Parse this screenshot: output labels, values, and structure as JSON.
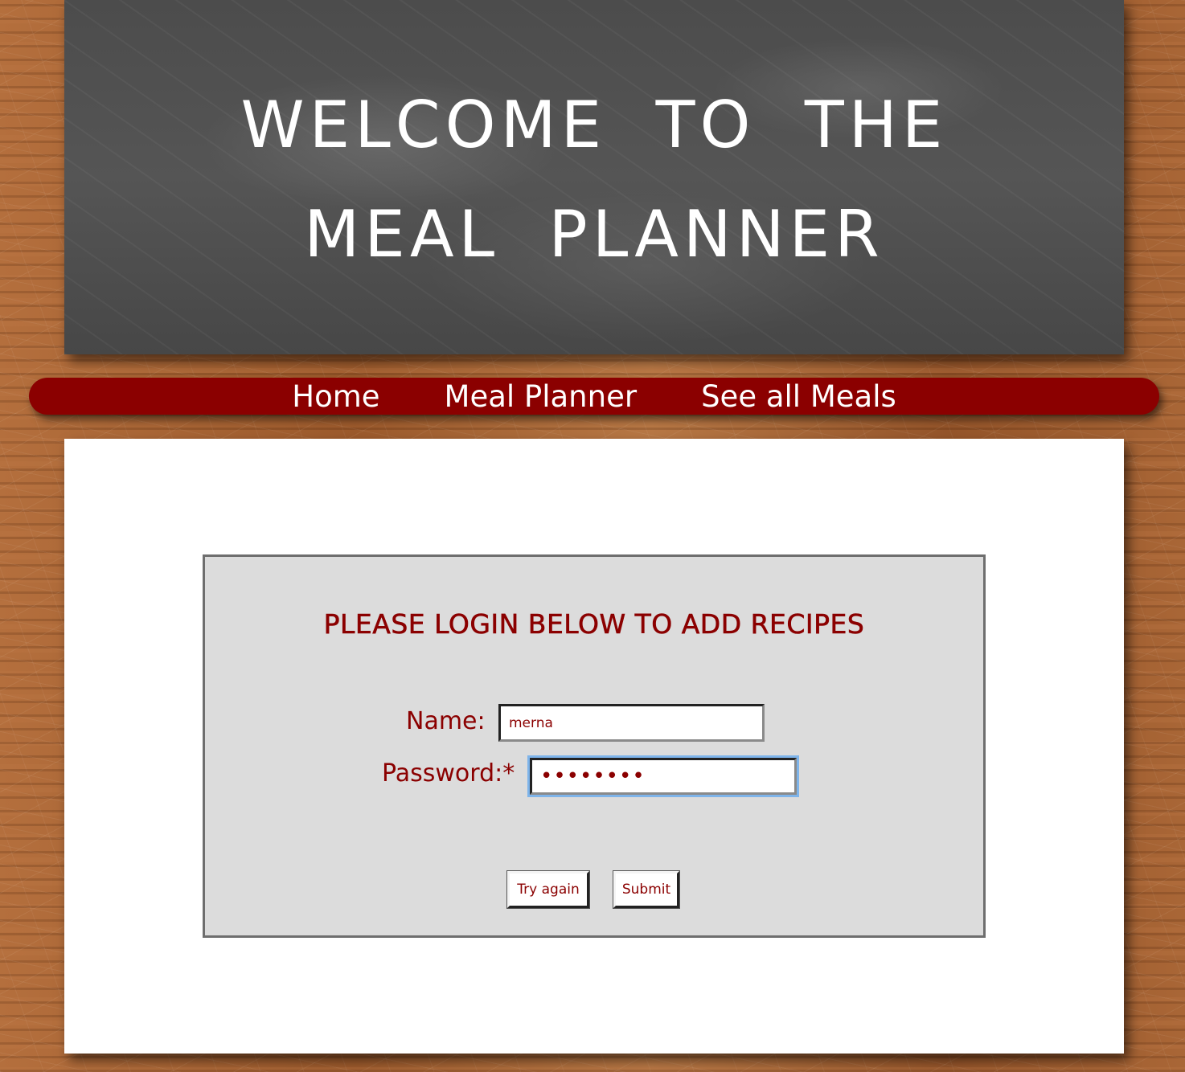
{
  "header": {
    "title": "WELCOME TO THE MEAL PLANNER"
  },
  "nav": {
    "items": [
      {
        "label": "Home"
      },
      {
        "label": "Meal Planner"
      },
      {
        "label": "See all Meals"
      }
    ]
  },
  "login": {
    "heading": "PLEASE LOGIN BELOW TO ADD RECIPES",
    "name_label": "Name:",
    "name_value": "merna",
    "password_label": "Password:*",
    "password_value": "merna123",
    "try_again_label": "Try again",
    "submit_label": "Submit"
  },
  "colors": {
    "accent": "#8b0000",
    "panel_bg": "#dcdcdc",
    "focus_ring": "#7eb4ea"
  }
}
